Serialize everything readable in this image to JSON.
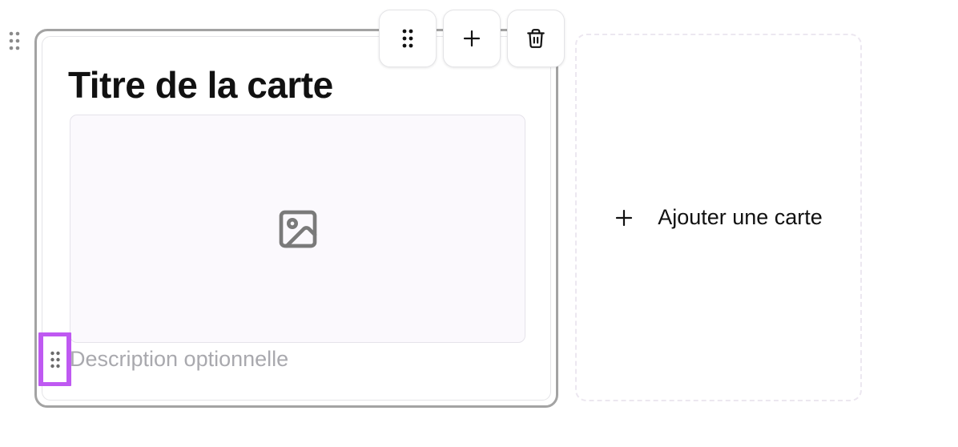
{
  "card": {
    "title": "Titre de la carte",
    "description_placeholder": "Description optionnelle",
    "image_icon": "image-icon"
  },
  "toolbar": {
    "drag_icon": "drag-handle-icon",
    "add_icon": "plus-icon",
    "delete_icon": "trash-icon"
  },
  "add_card": {
    "label": "Ajouter une carte",
    "icon": "plus-icon"
  },
  "colors": {
    "selection_border": "#a3a3a3",
    "highlight": "#bf59f2",
    "placeholder_bg": "#fbf9fd",
    "muted_text": "#a9a9ae",
    "dashed_border": "#ece7f0"
  }
}
